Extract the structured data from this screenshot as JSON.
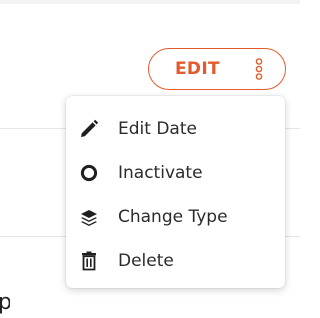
{
  "edit_button": {
    "label": "EDIT",
    "accent_color": "#e35b2d",
    "menu_icon": "more-vertical-icon"
  },
  "dropdown": {
    "items": [
      {
        "label": "Edit Date",
        "icon": "pencil-icon"
      },
      {
        "label": "Inactivate",
        "icon": "circle-icon"
      },
      {
        "label": "Change Type",
        "icon": "layers-icon"
      },
      {
        "label": "Delete",
        "icon": "trash-icon"
      }
    ]
  },
  "background": {
    "partial_text": "p"
  }
}
